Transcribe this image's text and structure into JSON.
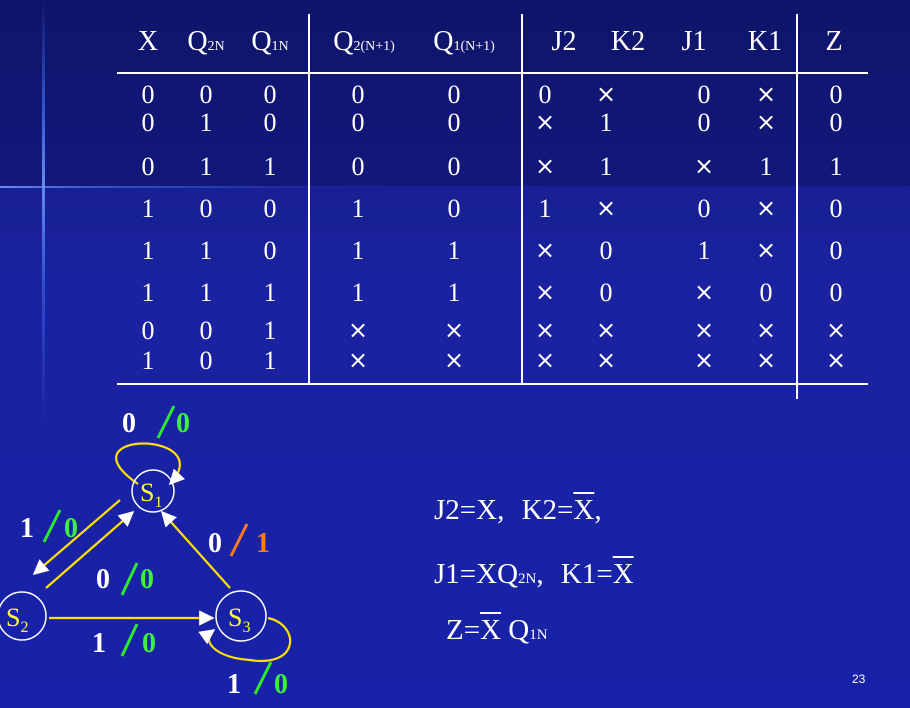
{
  "table": {
    "headers": {
      "x": "X",
      "q2n": {
        "main": "Q",
        "sub": "2N"
      },
      "q1n": {
        "main": "Q",
        "sub": "1N"
      },
      "q2n1": {
        "main": "Q",
        "sub": "2(N+1)"
      },
      "q1n1": {
        "main": "Q",
        "sub": "1(N+1)"
      },
      "j2": "J2",
      "k2": "K2",
      "j1": "J1",
      "k1": "K1",
      "z": "Z"
    },
    "rows": [
      [
        "0",
        "0",
        "0",
        "0",
        "0",
        "0",
        "×",
        "0",
        "×",
        "0"
      ],
      [
        "0",
        "1",
        "0",
        "0",
        "0",
        "×",
        "1",
        "0",
        "×",
        "0"
      ],
      [
        "0",
        "1",
        "1",
        "0",
        "0",
        "×",
        "1",
        "×",
        "1",
        "1"
      ],
      [
        "1",
        "0",
        "0",
        "1",
        "0",
        "1",
        "×",
        "0",
        "×",
        "0"
      ],
      [
        "1",
        "1",
        "0",
        "1",
        "1",
        "×",
        "0",
        "1",
        "×",
        "0"
      ],
      [
        "1",
        "1",
        "1",
        "1",
        "1",
        "×",
        "0",
        "×",
        "0",
        "0"
      ],
      [
        "0",
        "0",
        "1",
        "×",
        "×",
        "×",
        "×",
        "×",
        "×",
        "×"
      ],
      [
        "1",
        "0",
        "1",
        "×",
        "×",
        "×",
        "×",
        "×",
        "×",
        "×"
      ]
    ]
  },
  "diagram": {
    "states": [
      {
        "name": "S",
        "sub": "1"
      },
      {
        "name": "S",
        "sub": "2"
      },
      {
        "name": "S",
        "sub": "3"
      }
    ],
    "labels": {
      "s1_loop": {
        "input": "0",
        "output": "0"
      },
      "s1_to_s2": {
        "input": "1",
        "output": "0"
      },
      "s2_to_s1": {
        "input": "0",
        "output": "0"
      },
      "s3_to_s1": {
        "input": "0",
        "output": "1"
      },
      "s2_to_s3": {
        "input": "1",
        "output": "0"
      },
      "s3_loop": {
        "input": "1",
        "output": "0"
      }
    },
    "colors": {
      "circle": "#ffffff",
      "arrow": "#ffe000",
      "slash_green": "#2ee82e",
      "slash_orange": "#ff7a1a",
      "output_green": "#3cf03c",
      "output_orange": "#ff7a1a",
      "state_text": "#ffff33"
    }
  },
  "equations": {
    "line1": {
      "a": "J2=X,",
      "b": "K2=",
      "b_over": "X",
      "b_end": ","
    },
    "line2": {
      "a": "J1=XQ",
      "a_sub": "2N",
      "a_end": ",",
      "b": "K1=",
      "b_over": "X"
    },
    "line3": {
      "a": "Z=",
      "a_over": "X",
      "b": " Q",
      "b_sub": "1N"
    }
  },
  "page_number": "23"
}
